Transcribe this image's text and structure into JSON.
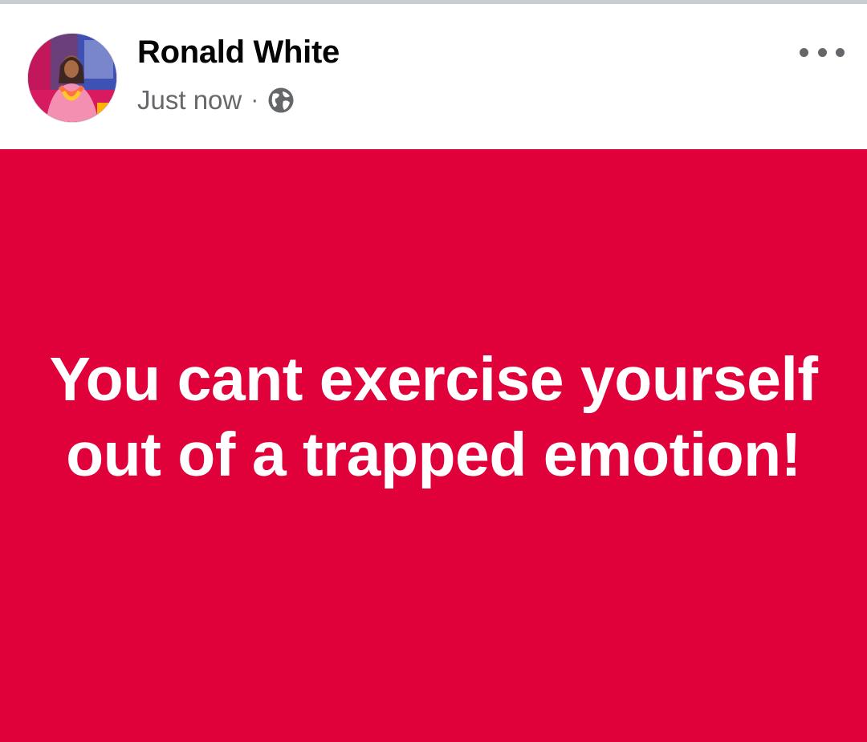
{
  "post": {
    "author": "Ronald White",
    "timestamp": "Just now",
    "separator": "·",
    "privacy_icon": "globe-icon",
    "more_icon": "more-options-icon",
    "text": "You cant exercise yourself out of a trapped emotion!",
    "background_color": "#E0003A",
    "text_color": "#FFFFFF"
  }
}
